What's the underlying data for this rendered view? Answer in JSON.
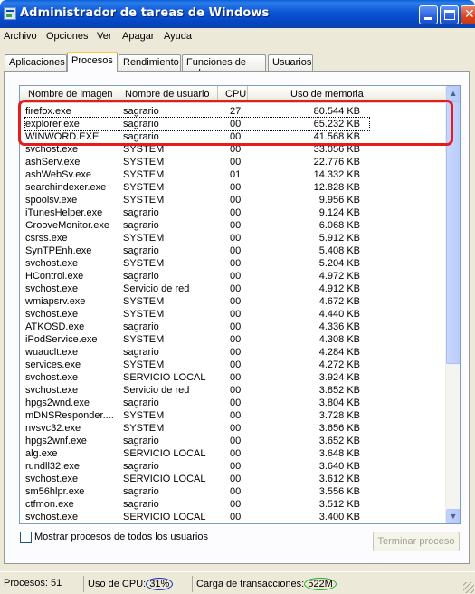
{
  "window": {
    "title": "Administrador de tareas de Windows"
  },
  "menu": [
    "Archivo",
    "Opciones",
    "Ver",
    "Apagar",
    "Ayuda"
  ],
  "tabs": [
    {
      "label": "Aplicaciones"
    },
    {
      "label": "Procesos",
      "active": true
    },
    {
      "label": "Rendimiento"
    },
    {
      "label": "Funciones de red"
    },
    {
      "label": "Usuarios"
    }
  ],
  "columns": {
    "name": "Nombre de imagen",
    "user": "Nombre de usuario",
    "cpu": "CPU",
    "memory": "Uso de memoria"
  },
  "processes": [
    {
      "name": "firefox.exe",
      "user": "sagrario",
      "cpu": "27",
      "mem": "80.544 KB"
    },
    {
      "name": "explorer.exe",
      "user": "sagrario",
      "cpu": "00",
      "mem": "65.232 KB"
    },
    {
      "name": "WINWORD.EXE",
      "user": "sagrario",
      "cpu": "00",
      "mem": "41.568 KB"
    },
    {
      "name": "svchost.exe",
      "user": "SYSTEM",
      "cpu": "00",
      "mem": "33.056 KB"
    },
    {
      "name": "ashServ.exe",
      "user": "SYSTEM",
      "cpu": "00",
      "mem": "22.776 KB"
    },
    {
      "name": "ashWebSv.exe",
      "user": "SYSTEM",
      "cpu": "01",
      "mem": "14.332 KB"
    },
    {
      "name": "searchindexer.exe",
      "user": "SYSTEM",
      "cpu": "00",
      "mem": "12.828 KB"
    },
    {
      "name": "spoolsv.exe",
      "user": "SYSTEM",
      "cpu": "00",
      "mem": "9.956 KB"
    },
    {
      "name": "iTunesHelper.exe",
      "user": "sagrario",
      "cpu": "00",
      "mem": "9.124 KB"
    },
    {
      "name": "GrooveMonitor.exe",
      "user": "sagrario",
      "cpu": "00",
      "mem": "6.068 KB"
    },
    {
      "name": "csrss.exe",
      "user": "SYSTEM",
      "cpu": "00",
      "mem": "5.912 KB"
    },
    {
      "name": "SynTPEnh.exe",
      "user": "sagrario",
      "cpu": "00",
      "mem": "5.408 KB"
    },
    {
      "name": "svchost.exe",
      "user": "SYSTEM",
      "cpu": "00",
      "mem": "5.204 KB"
    },
    {
      "name": "HControl.exe",
      "user": "sagrario",
      "cpu": "00",
      "mem": "4.972 KB"
    },
    {
      "name": "svchost.exe",
      "user": "Servicio de red",
      "cpu": "00",
      "mem": "4.912 KB"
    },
    {
      "name": "wmiapsrv.exe",
      "user": "SYSTEM",
      "cpu": "00",
      "mem": "4.672 KB"
    },
    {
      "name": "svchost.exe",
      "user": "SYSTEM",
      "cpu": "00",
      "mem": "4.440 KB"
    },
    {
      "name": "ATKOSD.exe",
      "user": "sagrario",
      "cpu": "00",
      "mem": "4.336 KB"
    },
    {
      "name": "iPodService.exe",
      "user": "SYSTEM",
      "cpu": "00",
      "mem": "4.308 KB"
    },
    {
      "name": "wuauclt.exe",
      "user": "sagrario",
      "cpu": "00",
      "mem": "4.284 KB"
    },
    {
      "name": "services.exe",
      "user": "SYSTEM",
      "cpu": "00",
      "mem": "4.272 KB"
    },
    {
      "name": "svchost.exe",
      "user": "SERVICIO LOCAL",
      "cpu": "00",
      "mem": "3.924 KB"
    },
    {
      "name": "svchost.exe",
      "user": "Servicio de red",
      "cpu": "00",
      "mem": "3.852 KB"
    },
    {
      "name": "hpgs2wnd.exe",
      "user": "sagrario",
      "cpu": "00",
      "mem": "3.804 KB"
    },
    {
      "name": "mDNSResponder....",
      "user": "SYSTEM",
      "cpu": "00",
      "mem": "3.728 KB"
    },
    {
      "name": "nvsvc32.exe",
      "user": "SYSTEM",
      "cpu": "00",
      "mem": "3.656 KB"
    },
    {
      "name": "hpgs2wnf.exe",
      "user": "sagrario",
      "cpu": "00",
      "mem": "3.652 KB"
    },
    {
      "name": "alg.exe",
      "user": "SERVICIO LOCAL",
      "cpu": "00",
      "mem": "3.648 KB"
    },
    {
      "name": "rundll32.exe",
      "user": "sagrario",
      "cpu": "00",
      "mem": "3.640 KB"
    },
    {
      "name": "svchost.exe",
      "user": "SERVICIO LOCAL",
      "cpu": "00",
      "mem": "3.612 KB"
    },
    {
      "name": "sm56hlpr.exe",
      "user": "sagrario",
      "cpu": "00",
      "mem": "3.556 KB"
    },
    {
      "name": "ctfmon.exe",
      "user": "sagrario",
      "cpu": "00",
      "mem": "3.512 KB"
    },
    {
      "name": "svchost.exe",
      "user": "SERVICIO LOCAL",
      "cpu": "00",
      "mem": "3.400 KB"
    }
  ],
  "show_all_users": {
    "label": "Mostrar procesos de todos los usuarios",
    "checked": false
  },
  "end_process_button": "Terminar proceso",
  "status": {
    "processes_label": "Procesos:",
    "processes_value": "51",
    "cpu_label": "Uso de CPU:",
    "cpu_value": "31%",
    "commit_label": "Carga de transacciones:",
    "commit_value": "522M"
  },
  "colors": {
    "highlight_box": "#e61b1b",
    "cpu_circle": "#1a2fd0",
    "commit_circle": "#2cae2c"
  }
}
